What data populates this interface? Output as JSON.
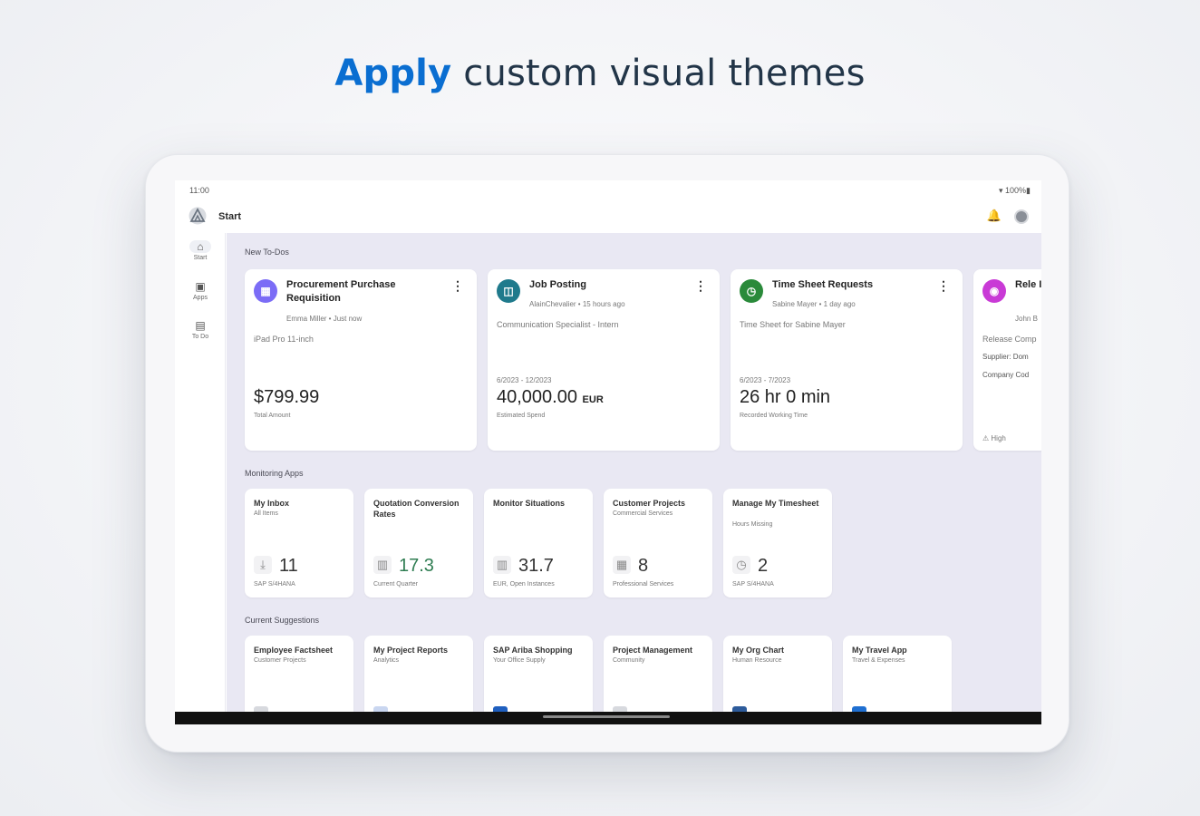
{
  "headline": {
    "accent": "Apply",
    "rest": " custom visual themes"
  },
  "statusbar": {
    "time": "11:00",
    "battery": "100%"
  },
  "appbar": {
    "title": "Start"
  },
  "nav": [
    {
      "label": "Start",
      "icon": "home-icon"
    },
    {
      "label": "Apps",
      "icon": "apps-icon"
    },
    {
      "label": "To Do",
      "icon": "todo-icon"
    }
  ],
  "sections": {
    "todos": "New To-Dos",
    "monitoring": "Monitoring Apps",
    "suggestions": "Current Suggestions"
  },
  "todos": [
    {
      "title": "Procurement Purchase Requisition",
      "meta": "Emma Miller • Just now",
      "desc": "iPad Pro 11-inch",
      "range": "",
      "amount": "$799.99",
      "currency": "",
      "sub": "Total Amount",
      "color": "#7b6cf6"
    },
    {
      "title": "Job Posting",
      "meta": "AlainChevalier • 15 hours ago",
      "desc": "Communication Specialist - Intern",
      "range": "6/2023 - 12/2023",
      "amount": "40,000.00",
      "currency": "EUR",
      "sub": "Estimated Spend",
      "color": "#1f7a8c"
    },
    {
      "title": "Time Sheet Requests",
      "meta": "Sabine Mayer • 1 day ago",
      "desc": "Time Sheet for Sabine Mayer",
      "range": "6/2023 - 7/2023",
      "amount": "26 hr 0 min",
      "currency": "",
      "sub": "Recorded Working Time",
      "color": "#2a8a3a"
    },
    {
      "title": "Rele Invo",
      "meta": "John B",
      "desc": "Release Comp",
      "line1": "Supplier: Dom",
      "line2": "Company Cod",
      "prio": "High",
      "color": "#c93ad6"
    }
  ],
  "monitoring": [
    {
      "title": "My Inbox",
      "sub": "All Items",
      "value": "11",
      "foot": "SAP S/4HANA",
      "icon": "inbox-icon"
    },
    {
      "title": "Quotation Conversion Rates",
      "sub": "",
      "value": "17.3",
      "foot": "Current Quarter",
      "icon": "chart-icon",
      "green": true
    },
    {
      "title": "Monitor Situations",
      "sub": "",
      "value": "31.7",
      "foot": "EUR, Open Instances",
      "icon": "chart-icon"
    },
    {
      "title": "Customer Projects",
      "sub": "Commercial Services",
      "value": "8",
      "foot": "Professional Services",
      "icon": "project-icon"
    },
    {
      "title": "Manage My Timesheet",
      "sub": "Hours Missing",
      "value": "2",
      "foot": "SAP S/4HANA",
      "icon": "clock-icon"
    }
  ],
  "suggestions": [
    {
      "title": "Employee Factsheet",
      "sub": "Customer Projects"
    },
    {
      "title": "My Project Reports",
      "sub": "Analytics"
    },
    {
      "title": "SAP Ariba Shopping",
      "sub": "Your Office Supply"
    },
    {
      "title": "Project Management",
      "sub": "Community"
    },
    {
      "title": "My Org Chart",
      "sub": "Human Resource"
    },
    {
      "title": "My Travel App",
      "sub": "Travel & Expenses"
    }
  ]
}
